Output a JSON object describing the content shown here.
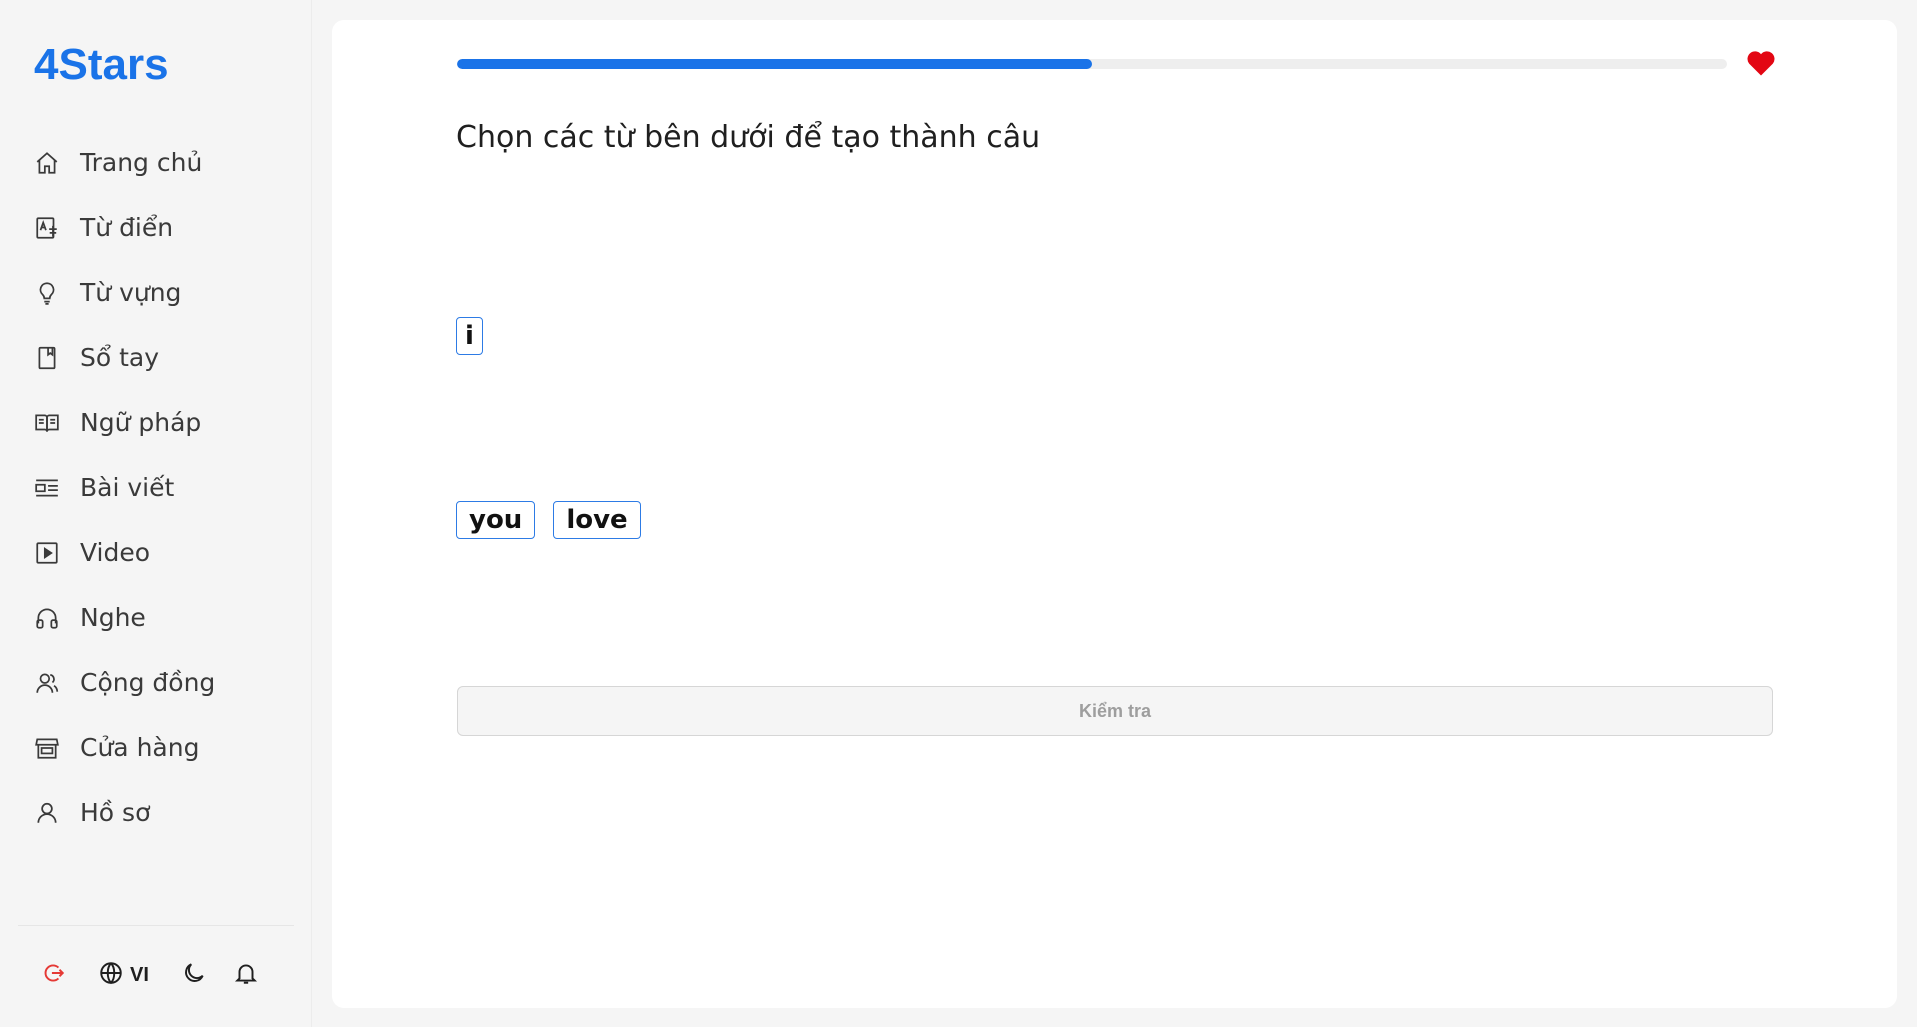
{
  "app": {
    "logo": "4Stars"
  },
  "sidebar": {
    "items": [
      {
        "label": "Trang chủ",
        "icon": "home-icon"
      },
      {
        "label": "Từ điển",
        "icon": "dictionary-icon"
      },
      {
        "label": "Từ vựng",
        "icon": "lightbulb-icon"
      },
      {
        "label": "Sổ tay",
        "icon": "notebook-icon"
      },
      {
        "label": "Ngữ pháp",
        "icon": "book-open-icon"
      },
      {
        "label": "Bài viết",
        "icon": "article-icon"
      },
      {
        "label": "Video",
        "icon": "video-icon"
      },
      {
        "label": "Nghe",
        "icon": "headphones-icon"
      },
      {
        "label": "Cộng đồng",
        "icon": "community-icon"
      },
      {
        "label": "Cửa hàng",
        "icon": "store-icon"
      },
      {
        "label": "Hồ sơ",
        "icon": "user-icon"
      }
    ],
    "bottom": {
      "language": "VI",
      "icons": [
        "logout-icon",
        "globe-icon",
        "moon-icon",
        "bell-icon"
      ],
      "logout_color": "#e53935"
    }
  },
  "exercise": {
    "progress_fraction": 0.5,
    "lives_icon": "heart-icon",
    "heart_color": "#e30613",
    "accent_color": "#1a73e8",
    "question": "Chọn các từ bên dưới để tạo thành câu",
    "selected_words": [
      "i"
    ],
    "word_bank": [
      "you",
      "love"
    ],
    "check_button": "Kiểm tra"
  }
}
